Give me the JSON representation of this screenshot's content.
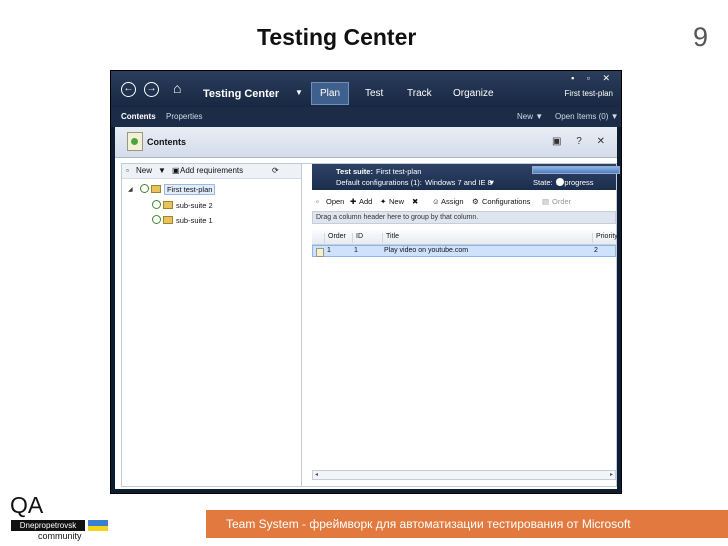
{
  "slide": {
    "title": "Testing Center",
    "page_number": "9",
    "footer_text": "Team System - фреймворк для автоматизации тестирования от Microsoft",
    "logo": {
      "qa": "QA",
      "city": "Dnepropetrovsk",
      "community": "community"
    }
  },
  "app": {
    "window_controls": "▪ ▫ ✕",
    "back_icon": "back-arrow-icon",
    "forward_icon": "forward-arrow-icon",
    "name": "Testing Center",
    "dropdown_glyph": "▼",
    "nav_tabs": [
      {
        "label": "Plan",
        "active": true
      },
      {
        "label": "Test",
        "active": false
      },
      {
        "label": "Track",
        "active": false
      },
      {
        "label": "Organize",
        "active": false
      }
    ],
    "current_plan": "First test-plan",
    "subtabs": [
      {
        "label": "Contents",
        "active": true
      },
      {
        "label": "Properties",
        "active": false
      }
    ],
    "new_menu": "New ▼",
    "open_items": "Open Items (0) ▼"
  },
  "contents": {
    "title": "Contents",
    "header_buttons": "▣ ? ✕",
    "tree_toolbar": {
      "new": "New",
      "new_dd": "▼",
      "add_requirements": "Add requirements",
      "refresh": "⟳"
    },
    "tree": {
      "expander": "◢",
      "root": "First test-plan",
      "children": [
        "sub-suite 2",
        "sub-suite 1"
      ]
    },
    "collapse_arrow": "◀",
    "suite": {
      "label": "Test suite:",
      "name": "First test-plan",
      "configs": "Default configurations (1):",
      "configs_value": "Windows 7 and IE 8",
      "configs_dd": "▼",
      "state_label": "State:",
      "state_value": "In progress",
      "state_dd": "▼"
    },
    "toolbar": {
      "open": "Open",
      "add": "Add",
      "new": "New",
      "assign": "Assign",
      "configurations": "Configurations",
      "order": "Order"
    },
    "group_hint": "Drag a column header here to group by that column.",
    "columns": [
      "Order",
      "ID",
      "Title",
      "Priority"
    ],
    "rows": [
      {
        "order": "1",
        "id": "1",
        "title": "Play video on youtube.com",
        "priority": "2"
      }
    ],
    "scroll_left": "◂",
    "scroll_right": "▸"
  },
  "colors": {
    "accent": "#e27a3f",
    "window": "#0f1d33"
  }
}
